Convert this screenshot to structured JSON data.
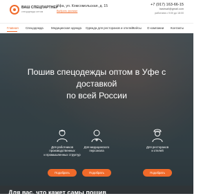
{
  "header": {
    "logo_text": "ВАШ СПЕЦПАРТНЕР",
    "logo_sub": "спецодежда оптом",
    "address": "Уфа, ул. Комсомольская, д. 15",
    "address_link": "Выбрать филиал",
    "phone": "+7 (917) 163-66-15",
    "email": "bashsall@gmail.com",
    "hours": "работаем с 9:00 до 18:00"
  },
  "nav": {
    "items": [
      "Главная",
      "Спецодежда",
      "Медицинская одежда",
      "Одежда для ресторанов и отелей",
      "Кейсы",
      "О компании",
      "Контакты"
    ]
  },
  "hero": {
    "title_line1": "Пошив спецодежды оптом в Уфе с доставкой",
    "title_line2": "по всей России"
  },
  "cards": [
    {
      "line1": "Для работников",
      "line2": "производственных",
      "line3": "и промышленных структур",
      "button": "Подобрать"
    },
    {
      "line1": "Для медицинского",
      "line2": "персонала",
      "line3": "",
      "button": "Подобрать"
    },
    {
      "line1": "Для ресторанов",
      "line2": "и отелей",
      "line3": "",
      "button": "Подобрать"
    }
  ],
  "footer": {
    "text": "Для вас, что кажет самы пошив"
  },
  "colors": {
    "accent": "#f06a2a",
    "hero_bg": "#3d474c"
  }
}
